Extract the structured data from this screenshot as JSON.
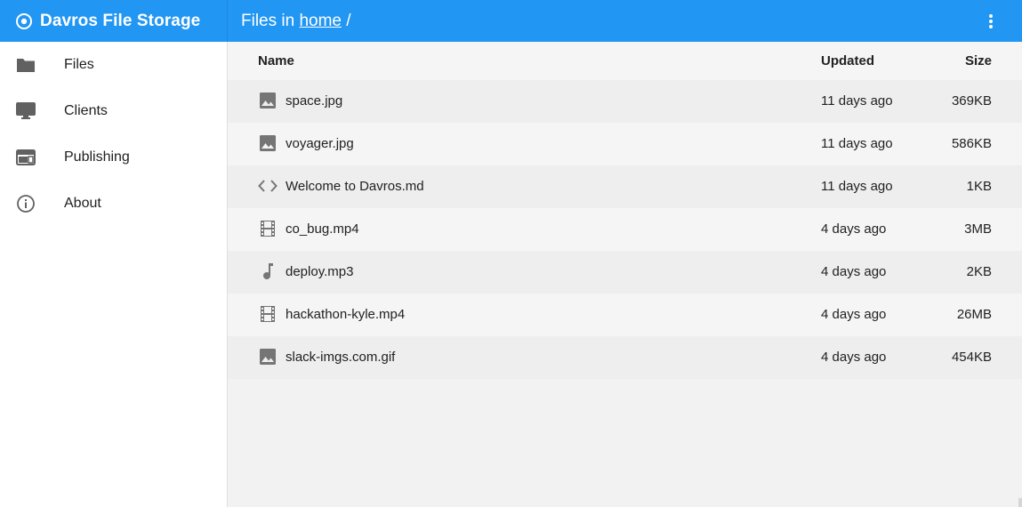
{
  "brand": {
    "title": "Davros File Storage",
    "icon": "radio-target-icon",
    "color": "#2196f3"
  },
  "appbar": {
    "prefix": "Files in ",
    "crumb": "home",
    "separator": " /",
    "more_icon": "more-vert-icon"
  },
  "sidebar": {
    "items": [
      {
        "label": "Files",
        "icon": "folder-icon"
      },
      {
        "label": "Clients",
        "icon": "monitor-icon"
      },
      {
        "label": "Publishing",
        "icon": "web-window-icon"
      },
      {
        "label": "About",
        "icon": "info-icon"
      }
    ]
  },
  "table": {
    "headers": {
      "name": "Name",
      "updated": "Updated",
      "size": "Size"
    },
    "rows": [
      {
        "name": "space.jpg",
        "updated": "11 days ago",
        "size": "369KB",
        "icon": "image-icon"
      },
      {
        "name": "voyager.jpg",
        "updated": "11 days ago",
        "size": "586KB",
        "icon": "image-icon"
      },
      {
        "name": "Welcome to Davros.md",
        "updated": "11 days ago",
        "size": "1KB",
        "icon": "code-icon"
      },
      {
        "name": "co_bug.mp4",
        "updated": "4 days ago",
        "size": "3MB",
        "icon": "film-icon"
      },
      {
        "name": "deploy.mp3",
        "updated": "4 days ago",
        "size": "2KB",
        "icon": "music-note-icon"
      },
      {
        "name": "hackathon-kyle.mp4",
        "updated": "4 days ago",
        "size": "26MB",
        "icon": "film-icon"
      },
      {
        "name": "slack-imgs.com.gif",
        "updated": "4 days ago",
        "size": "454KB",
        "icon": "image-icon"
      }
    ]
  }
}
